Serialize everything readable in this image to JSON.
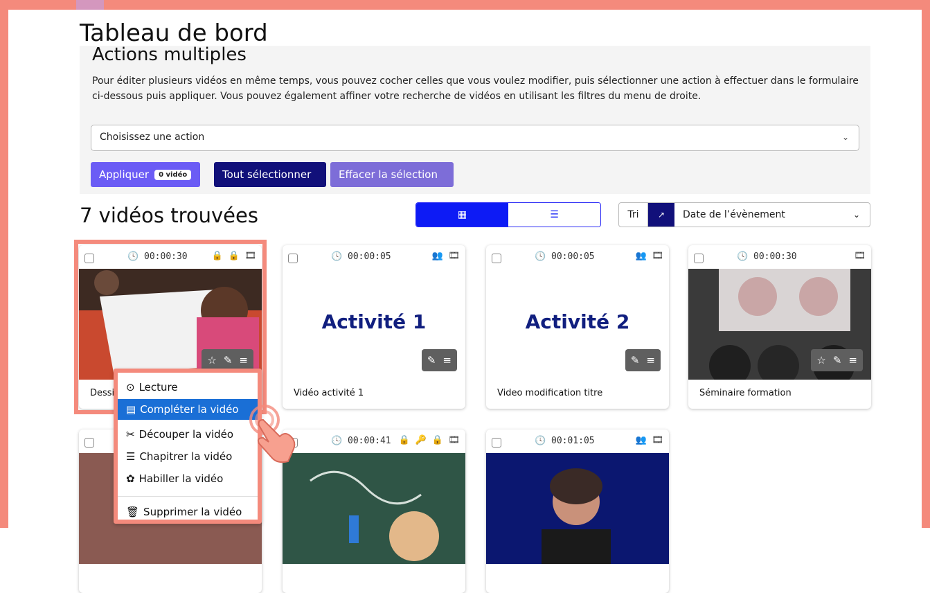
{
  "page": {
    "title": "Tableau de bord"
  },
  "actions": {
    "title": "Actions multiples",
    "description": "Pour éditer plusieurs vidéos en même temps, vous pouvez cocher celles que vous voulez modifier, puis sélectionner une action à effectuer dans le formulaire ci-dessous puis appliquer. Vous pouvez également affiner votre recherche de vidéos en utilisant les filtres du menu de droite.",
    "select_placeholder": "Choisissez une action",
    "apply_label": "Appliquer",
    "apply_badge": "0 vidéo",
    "select_all_label": "Tout sélectionner",
    "clear_label": "Effacer la sélection"
  },
  "results": {
    "title": "7 vidéos trouvées",
    "sort_label": "Tri",
    "sort_value": "Date de l’évènement"
  },
  "cards": [
    {
      "duration": "00:00:30",
      "name": "Dessi",
      "flags": "🔒 🔒 🎞"
    },
    {
      "duration": "00:00:05",
      "name": "Vidéo activité 1",
      "flags": "👥 🎞",
      "thumb_text": "Activité 1"
    },
    {
      "duration": "00:00:05",
      "name": "Video modification titre",
      "flags": "👥 🎞",
      "thumb_text": "Activité 2"
    },
    {
      "duration": "00:00:30",
      "name": "Séminaire formation",
      "flags": "🎞"
    },
    {
      "duration": "",
      "name": "",
      "flags": ""
    },
    {
      "duration": "00:00:41",
      "name": "",
      "flags": "🔒 🔑 🔒 🎞"
    },
    {
      "duration": "00:01:05",
      "name": "",
      "flags": "👥 🎞"
    }
  ],
  "menu": {
    "items": [
      {
        "label": "Lecture",
        "icon": "play-circle-icon"
      },
      {
        "label": "Compléter la vidéo",
        "icon": "document-icon"
      },
      {
        "label": "Découper la vidéo",
        "icon": "scissors-icon"
      },
      {
        "label": "Chapitrer la vidéo",
        "icon": "list-icon"
      },
      {
        "label": "Habiller la vidéo",
        "icon": "palette-icon"
      },
      {
        "label": "Supprimer la vidéo",
        "icon": "trash-icon"
      }
    ]
  },
  "colors": {
    "accent": "#0d1bf5",
    "navy": "#11107a",
    "purple": "#6b5cf5",
    "highlight": "#f48a7c",
    "menu_active": "#1a6fd6"
  }
}
